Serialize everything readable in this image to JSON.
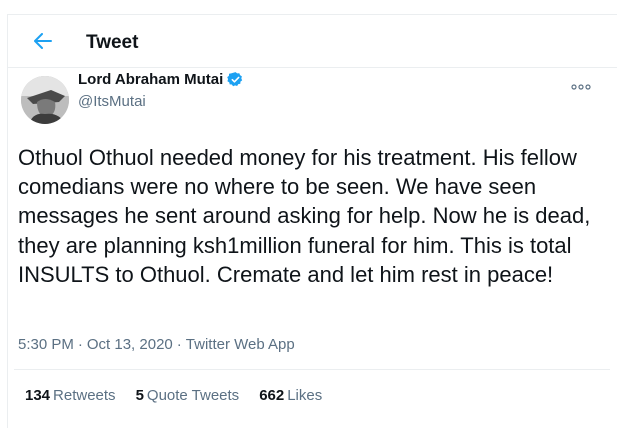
{
  "header": {
    "title": "Tweet",
    "back_icon": "arrow-left-icon"
  },
  "tweet": {
    "author": {
      "name": "Lord Abraham Mutai",
      "handle": "@ItsMutai",
      "verified": true
    },
    "text": "Othuol Othuol needed money for his treatment. His fellow comedians were no where to be seen. We have seen messages he sent around asking for help. Now he is dead, they are planning ksh1million funeral for him. This is total INSULTS to Othuol. Cremate and let him rest in peace!",
    "time": "5:30 PM",
    "separator1": "·",
    "date": "Oct 13, 2020",
    "separator2": "·",
    "source": "Twitter Web App",
    "stats": {
      "retweets_count": "134",
      "retweets_label": "Retweets",
      "quote_count": "5",
      "quote_label": "Quote Tweets",
      "likes_count": "662",
      "likes_label": "Likes"
    }
  },
  "colors": {
    "accent": "#1da1f2",
    "text": "#0f1419",
    "secondary": "#5b7083",
    "border": "#ebeef0"
  }
}
